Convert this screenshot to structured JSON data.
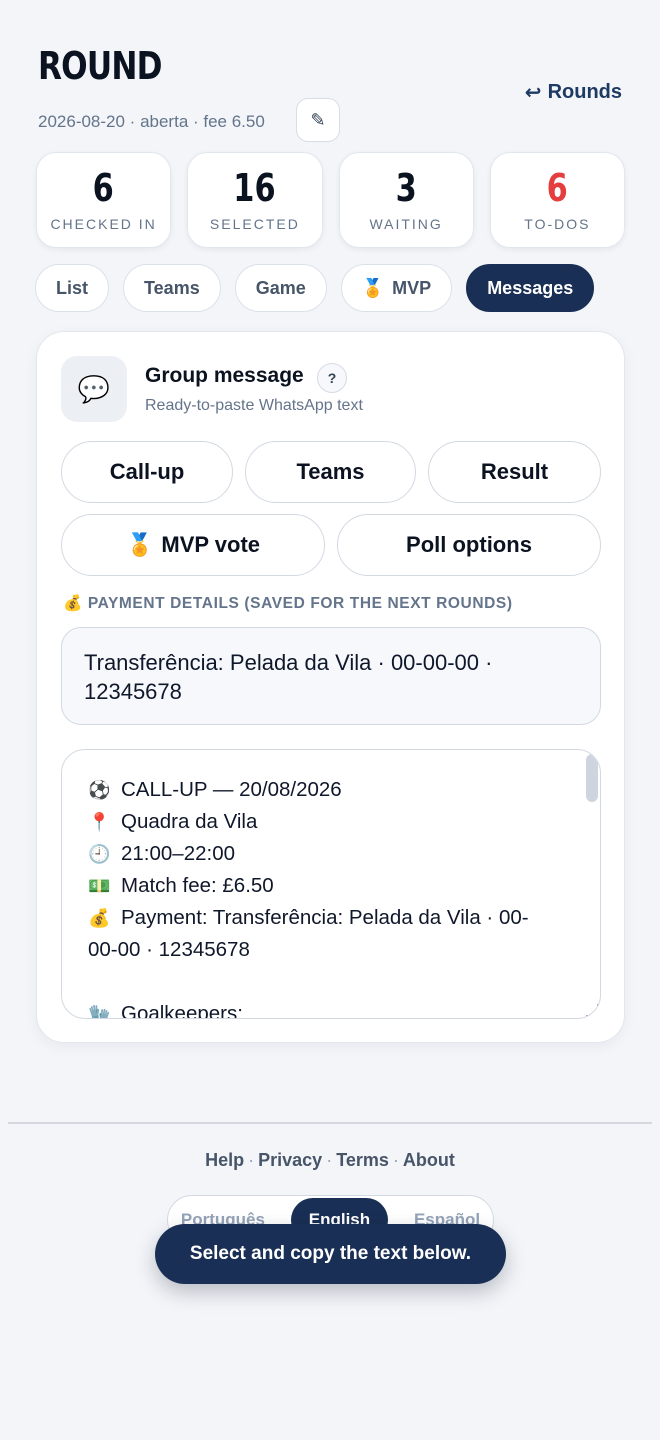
{
  "header": {
    "title": "ROUND",
    "meta": "2026-08-20 · aberta · fee 6.50",
    "back_label": "Rounds",
    "back_icon": "↩",
    "edit_icon": "✎"
  },
  "stats": [
    {
      "value": "6",
      "label": "CHECKED IN"
    },
    {
      "value": "16",
      "label": "SELECTED"
    },
    {
      "value": "3",
      "label": "WAITING"
    },
    {
      "value": "6",
      "label": "TO-DOS",
      "color": "#e53e3e"
    }
  ],
  "tabs": [
    {
      "label": "List"
    },
    {
      "label": "Teams"
    },
    {
      "label": "Game"
    },
    {
      "label": "MVP",
      "icon": "🏅"
    },
    {
      "label": "Messages",
      "active": true
    }
  ],
  "group_message": {
    "icon": "💬",
    "title": "Group message",
    "help": "?",
    "subtitle": "Ready-to-paste WhatsApp text",
    "buttons": [
      "Call-up",
      "Teams",
      "Result"
    ],
    "mvp_vote": {
      "icon": "🏅",
      "label": "MVP vote"
    },
    "poll_options": "Poll options",
    "payment_label": "PAYMENT DETAILS (SAVED FOR THE NEXT ROUNDS)",
    "payment_icon": "💰",
    "payment_value": "Transferência: Pelada da Vila · 00-00-00 · 12345678",
    "message_lines": [
      {
        "emoji": "⚽",
        "text": "CALL-UP — 20/08/2026"
      },
      {
        "emoji": "📍",
        "text": "Quadra da Vila"
      },
      {
        "emoji": "🕘",
        "text": "21:00–22:00"
      },
      {
        "emoji": "💵",
        "text": "Match fee: £6.50"
      },
      {
        "emoji": "💰",
        "text": "Payment: Transferência: Pelada da Vila · 00-00-00 · 12345678"
      },
      {
        "emoji": "",
        "text": ""
      },
      {
        "emoji": "🧤",
        "text": "Goalkeepers:"
      }
    ]
  },
  "footer": {
    "links": [
      "Help",
      "Privacy",
      "Terms",
      "About"
    ],
    "separator": "·",
    "languages": [
      {
        "label": "Português"
      },
      {
        "label": "English",
        "active": true
      },
      {
        "label": "Español"
      }
    ]
  },
  "toast": "Select and copy the text below."
}
